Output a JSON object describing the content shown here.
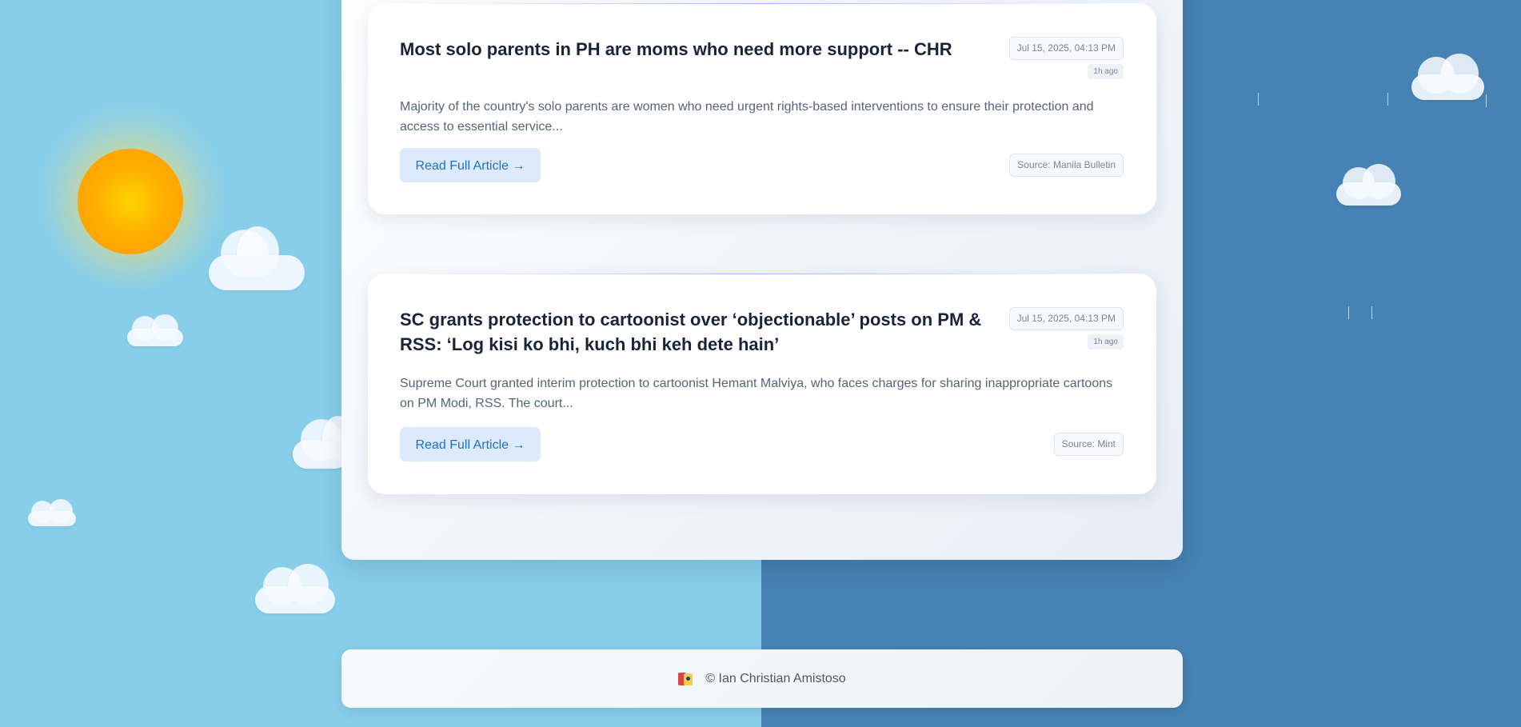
{
  "articles": [
    {
      "title": "Most solo parents in PH are moms who need more support -- CHR",
      "date": "Jul 15, 2025, 04:13 PM",
      "ago": "1h ago",
      "description": "Majority of the country's solo parents are women who need urgent rights-based interventions to ensure their protection and access to essential service...",
      "read_label": "Read Full Article →",
      "source": "Source: Manila Bulletin"
    },
    {
      "title": "SC grants protection to cartoonist over ‘objectionable’ posts on PM & RSS: ‘Log kisi ko bhi, kuch bhi keh dete hain’",
      "date": "Jul 15, 2025, 04:13 PM",
      "ago": "1h ago",
      "description": "Supreme Court granted interim protection to cartoonist Hemant Malviya, who faces charges for sharing inappropriate cartoons on PM Modi, RSS. The court...",
      "read_label": "Read Full Article →",
      "source": "Source: Mint"
    }
  ],
  "footer": {
    "icon": "profile-icon",
    "text": "© Ian Christian Amistoso"
  },
  "colors": {
    "sky_day": "#87ceeb",
    "sky_rain": "#4682b4",
    "accent": "#1f6fd0",
    "button_bg": "#ddeafb",
    "title": "#1a2438"
  }
}
